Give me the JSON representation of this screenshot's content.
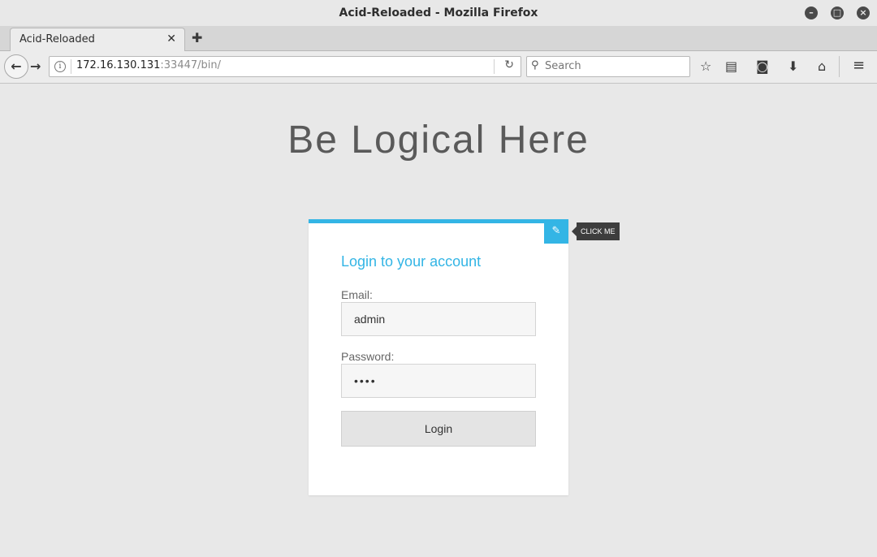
{
  "window": {
    "title": "Acid-Reloaded - Mozilla Firefox",
    "controls": {
      "minimize": "–",
      "maximize": "□",
      "close": "×"
    }
  },
  "tabs": [
    {
      "label": "Acid-Reloaded",
      "active": true
    }
  ],
  "nav": {
    "url_host": "172.16.130.131",
    "url_path": ":33447/bin/",
    "search_placeholder": "Search"
  },
  "toolbar_icons": [
    "star-icon",
    "reading-list-icon",
    "pocket-icon",
    "download-icon",
    "home-icon",
    "menu-icon"
  ],
  "page": {
    "headline": "Be Logical Here",
    "login": {
      "title": "Login to your account",
      "email_label": "Email:",
      "email_value": "admin",
      "password_label": "Password:",
      "password_value": "••••",
      "button_label": "Login"
    },
    "tooltip": "CLICK ME"
  },
  "colors": {
    "accent": "#33b5e5",
    "background": "#e8e8e8"
  }
}
